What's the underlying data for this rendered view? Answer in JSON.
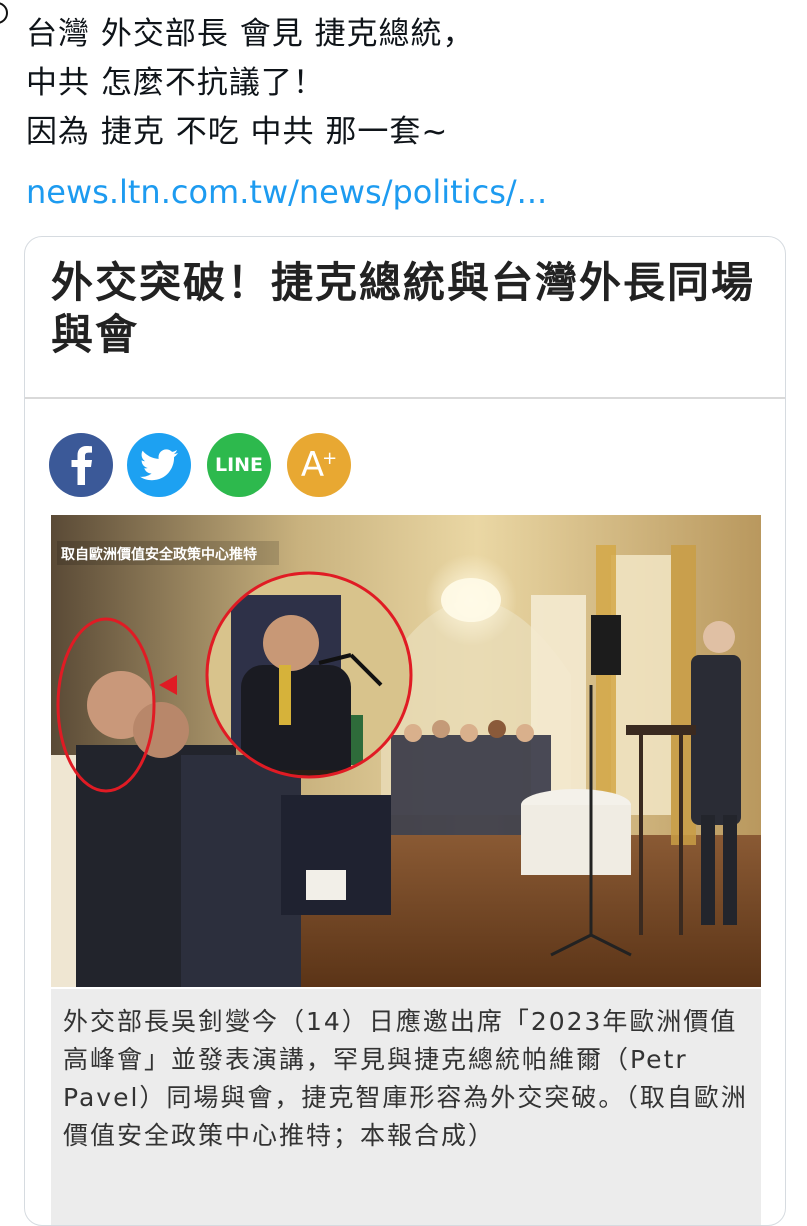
{
  "tweet": {
    "lines": [
      "台灣 外交部長 會見 捷克總統，",
      "中共 怎麼不抗議了！",
      "因為 捷克 不吃 中共 那一套~"
    ],
    "link": "news.ltn.com.tw/news/politics/..."
  },
  "card": {
    "headline": "外交突破！捷克總統與台灣外長同場與會",
    "share": {
      "facebook_icon": "f",
      "line_label": "LINE",
      "font_size_label": "A",
      "font_size_sup": "+"
    },
    "photo": {
      "credit": "取自歐洲價值安全政策中心推特",
      "description_icon": "conference-photo"
    },
    "caption": "外交部長吳釗燮今（14）日應邀出席「2023年歐洲價值高峰會」並發表演講，罕見與捷克總統帕維爾（Petr Pavel）同場與會，捷克智庫形容為外交突破。（取自歐洲價值安全政策中心推特；本報合成）"
  },
  "colors": {
    "link": "#1d9bf0",
    "facebook": "#3b5998",
    "twitter": "#1da1f2",
    "line": "#2db94d",
    "font_size": "#e8a832",
    "highlight_circle": "#e01b24"
  }
}
